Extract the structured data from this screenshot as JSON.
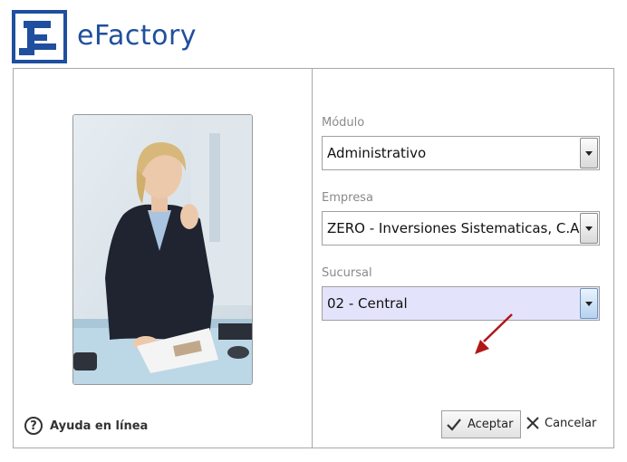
{
  "app": {
    "brand": "eFactory",
    "logo_icon": "efactory-logo-icon",
    "brand_color": "#1f4f9e"
  },
  "left": {
    "photo": "businesswoman-photo",
    "help_label": "Ayuda en línea",
    "help_icon": "question-circle-icon"
  },
  "form": {
    "modulo_label": "Módulo",
    "modulo_value": "Administrativo",
    "empresa_label": "Empresa",
    "empresa_value": "ZERO - Inversiones Sistematicas, C.A.",
    "sucursal_label": "Sucursal",
    "sucursal_value": "02 - Central",
    "active_field_color": "#e3e4fb"
  },
  "actions": {
    "accept_label": "Aceptar",
    "accept_icon": "checkmark-icon",
    "cancel_label": "Cancelar",
    "cancel_icon": "x-icon",
    "pointer_icon": "red-arrow-pointer-icon"
  }
}
